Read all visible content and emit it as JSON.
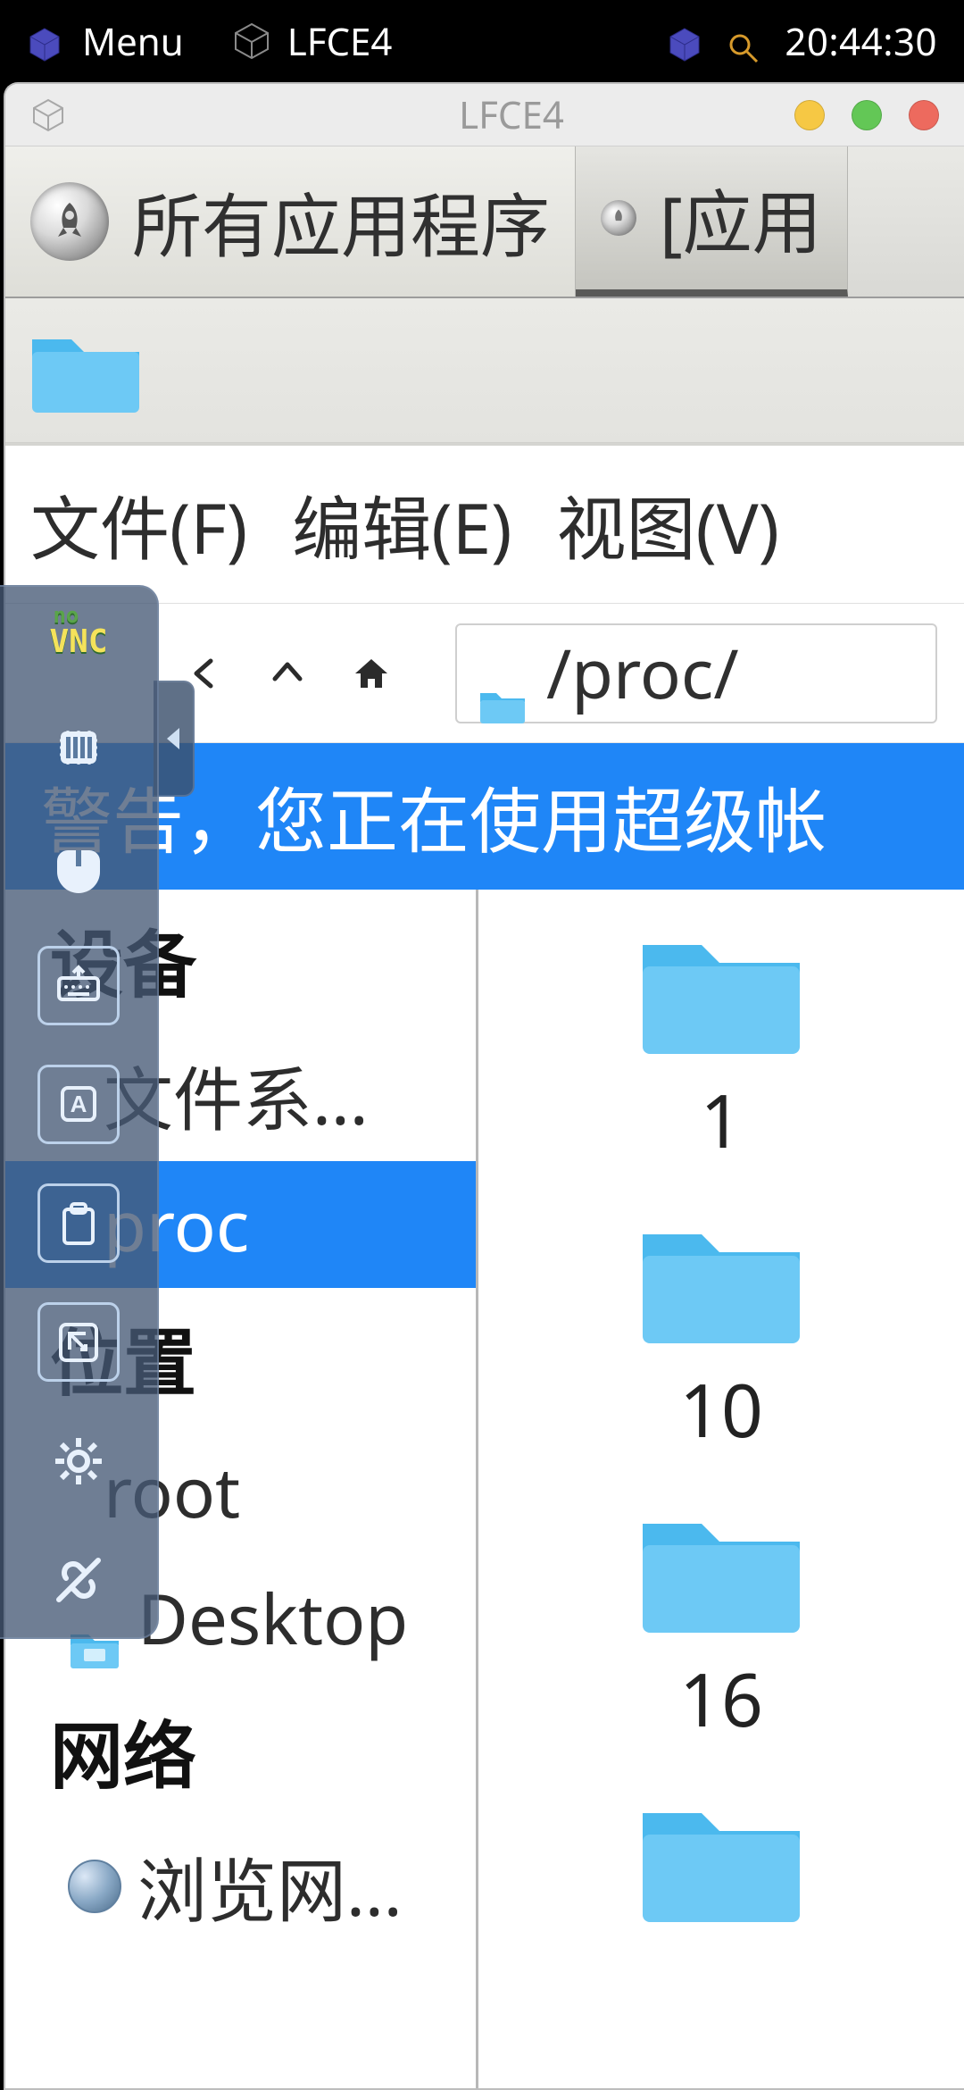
{
  "statusbar": {
    "menu_label": "Menu",
    "task_label": "LFCE4",
    "clock": "20:44:30"
  },
  "window": {
    "title": "LFCE4"
  },
  "tabs": {
    "all_apps": "所有应用程序",
    "secondary": "[应用"
  },
  "menus": {
    "file": "文件(F)",
    "edit": "编辑(E)",
    "view": "视图(V)"
  },
  "nav": {
    "path": "/proc/"
  },
  "banner": {
    "text": "警告，您正在使用超级帐"
  },
  "sidebar": {
    "devices_header": "设备",
    "filesystem": "文件系...",
    "proc": "proc",
    "places_header": "位置",
    "root": "root",
    "desktop": "Desktop",
    "network_header": "网络",
    "browse_network": "浏览网..."
  },
  "folders": {
    "f1": "1",
    "f2": "10",
    "f3": "16"
  },
  "novnc": {
    "brand_no": "no",
    "brand_vnc": "VNC"
  }
}
